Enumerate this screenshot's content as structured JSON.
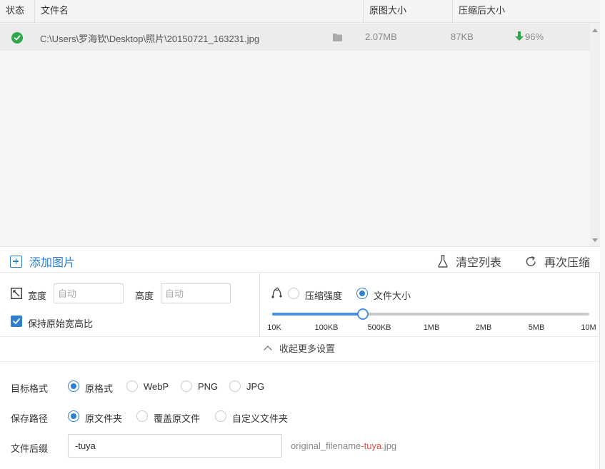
{
  "table": {
    "headers": [
      "状态",
      "文件名",
      "原图大小",
      "压缩后大小"
    ],
    "rows": [
      {
        "status_icon": "check-circle-icon",
        "filename": "C:\\Users\\罗海钦\\Desktop\\照片\\20150721_163231.jpg",
        "folder_icon": "folder-icon",
        "original_size": "2.07MB",
        "compressed_size": "87KB",
        "ratio": "96%",
        "ratio_icon": "arrow-down-icon"
      }
    ]
  },
  "actions": {
    "add_label": "添加图片",
    "clear_label": "清空列表",
    "recompress_label": "再次压缩"
  },
  "size": {
    "width_label": "宽度",
    "width_placeholder": "自动",
    "height_label": "高度",
    "height_placeholder": "自动",
    "keep_ratio_label": "保持原始宽高比",
    "keep_ratio_checked": true
  },
  "compress_mode": {
    "options": [
      "压缩强度",
      "文件大小"
    ],
    "selected": "文件大小",
    "slider_ticks": [
      "10K",
      "100KB",
      "500KB",
      "1MB",
      "2MB",
      "5MB",
      "10M"
    ],
    "slider_value": "500KB"
  },
  "more_toggle_label": "收起更多设置",
  "target_format": {
    "label": "目标格式",
    "options": [
      "原格式",
      "WebP",
      "PNG",
      "JPG"
    ],
    "selected": "原格式"
  },
  "save_path": {
    "label": "保存路径",
    "options": [
      "原文件夹",
      "覆盖原文件",
      "自定义文件夹"
    ],
    "selected": "原文件夹"
  },
  "suffix": {
    "label": "文件后缀",
    "value": "-tuya",
    "hint_prefix": "original_filename",
    "hint_suffix": "-tuya",
    "hint_ext": ".jpg"
  },
  "colors": {
    "accent": "#2f7fd1",
    "success": "#2ea84a",
    "highlight": "#d9534f"
  }
}
